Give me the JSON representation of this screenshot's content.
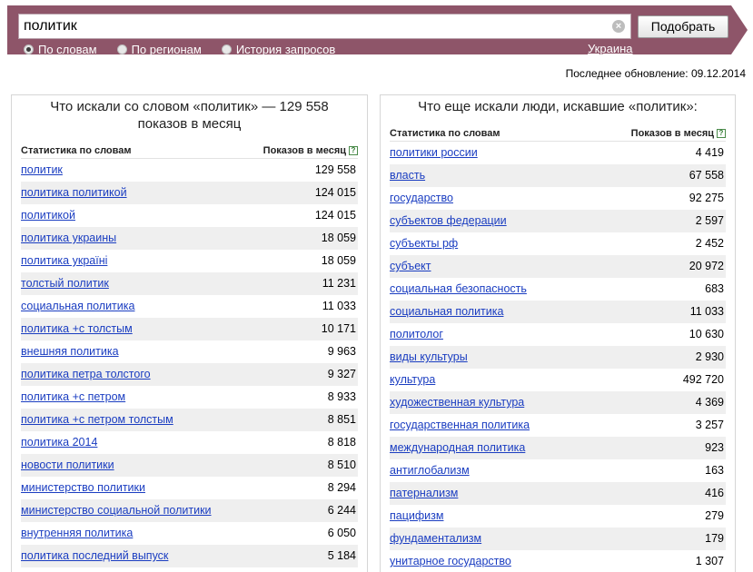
{
  "search": {
    "query": "политик",
    "clear_symbol": "×",
    "submit_label": "Подобрать",
    "modes": [
      {
        "label": "По словам",
        "checked": true
      },
      {
        "label": "По регионам",
        "checked": false
      },
      {
        "label": "История запросов",
        "checked": false
      }
    ],
    "region": "Украина"
  },
  "last_update": "Последнее обновление: 09.12.2014",
  "left_panel": {
    "title_line1": "Что искали со словом «политик» — 129 558",
    "title_line2": "показов в месяц",
    "col_word": "Статистика по словам",
    "col_count": "Показов в месяц",
    "help": "?",
    "rows": [
      {
        "word": "политик",
        "count": "129 558"
      },
      {
        "word": "политика политикой",
        "count": "124 015"
      },
      {
        "word": "политикой",
        "count": "124 015"
      },
      {
        "word": "политика украины",
        "count": "18 059"
      },
      {
        "word": "политика україні",
        "count": "18 059"
      },
      {
        "word": "толстый политик",
        "count": "11 231"
      },
      {
        "word": "социальная политика",
        "count": "11 033"
      },
      {
        "word": "политика +с толстым",
        "count": "10 171"
      },
      {
        "word": "внешняя политика",
        "count": "9 963"
      },
      {
        "word": "политика петра толстого",
        "count": "9 327"
      },
      {
        "word": "политика +с петром",
        "count": "8 933"
      },
      {
        "word": "политика +с петром толстым",
        "count": "8 851"
      },
      {
        "word": "политика 2014",
        "count": "8 818"
      },
      {
        "word": "новости политики",
        "count": "8 510"
      },
      {
        "word": "министерство политики",
        "count": "8 294"
      },
      {
        "word": "министерство социальной политики",
        "count": "6 244"
      },
      {
        "word": "внутренняя политика",
        "count": "6 050"
      },
      {
        "word": "политика последний выпуск",
        "count": "5 184"
      }
    ]
  },
  "right_panel": {
    "title": "Что еще искали люди, искавшие «политик»:",
    "col_word": "Статистика по словам",
    "col_count": "Показов в месяц",
    "help": "?",
    "rows": [
      {
        "word": "политики россии",
        "count": "4 419"
      },
      {
        "word": "власть",
        "count": "67 558"
      },
      {
        "word": "государство",
        "count": "92 275"
      },
      {
        "word": "субъектов федерации",
        "count": "2 597"
      },
      {
        "word": "субъекты рф",
        "count": "2 452"
      },
      {
        "word": "субъект",
        "count": "20 972"
      },
      {
        "word": "социальная безопасность",
        "count": "683"
      },
      {
        "word": "социальная политика",
        "count": "11 033"
      },
      {
        "word": "политолог",
        "count": "10 630"
      },
      {
        "word": "виды культуры",
        "count": "2 930"
      },
      {
        "word": "культура",
        "count": "492 720"
      },
      {
        "word": "художественная культура",
        "count": "4 369"
      },
      {
        "word": "государственная политика",
        "count": "3 257"
      },
      {
        "word": "международная политика",
        "count": "923"
      },
      {
        "word": "антиглобализм",
        "count": "163"
      },
      {
        "word": "патернализм",
        "count": "416"
      },
      {
        "word": "пацифизм",
        "count": "279"
      },
      {
        "word": "фундаментализм",
        "count": "179"
      },
      {
        "word": "унитарное государство",
        "count": "1 307"
      }
    ]
  },
  "colors": {
    "band": "#8e5569",
    "link": "#1a3dc1",
    "row_stripe": "#efefef"
  }
}
